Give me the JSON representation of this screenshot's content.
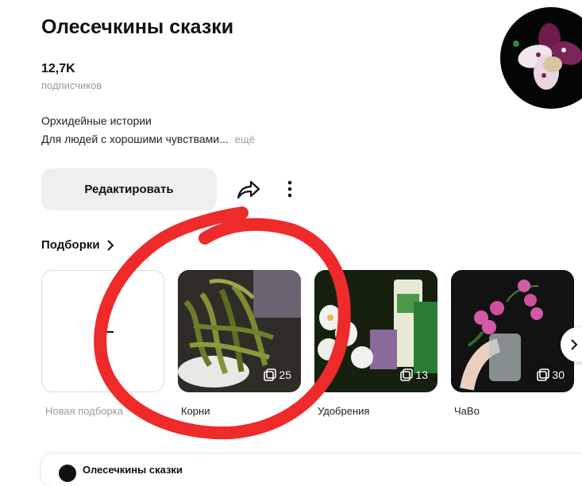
{
  "channel": {
    "title": "Олесечкины сказки",
    "subscribers_count": "12,7K",
    "subscribers_label": "подписчиков",
    "description_line1": "Орхидейные истории",
    "description_line2": "Для людей с хорошими чувствами...",
    "more_label": "ещё"
  },
  "actions": {
    "edit_label": "Редактировать",
    "share_icon": "share-arrow-icon",
    "more_icon": "vertical-dots-icon"
  },
  "collections": {
    "heading": "Подборки",
    "items": [
      {
        "label": "Новая подборка",
        "count": "",
        "icon": "plus-icon"
      },
      {
        "label": "Корни",
        "count": "25"
      },
      {
        "label": "Удобрения",
        "count": "13"
      },
      {
        "label": "ЧаВо",
        "count": "30"
      }
    ]
  },
  "bottom_card": {
    "name": "Олесечкины сказки"
  },
  "colors": {
    "accent_annotation": "#ee2a2a",
    "button_bg": "#efefef",
    "muted_text": "#9a9a9a"
  }
}
